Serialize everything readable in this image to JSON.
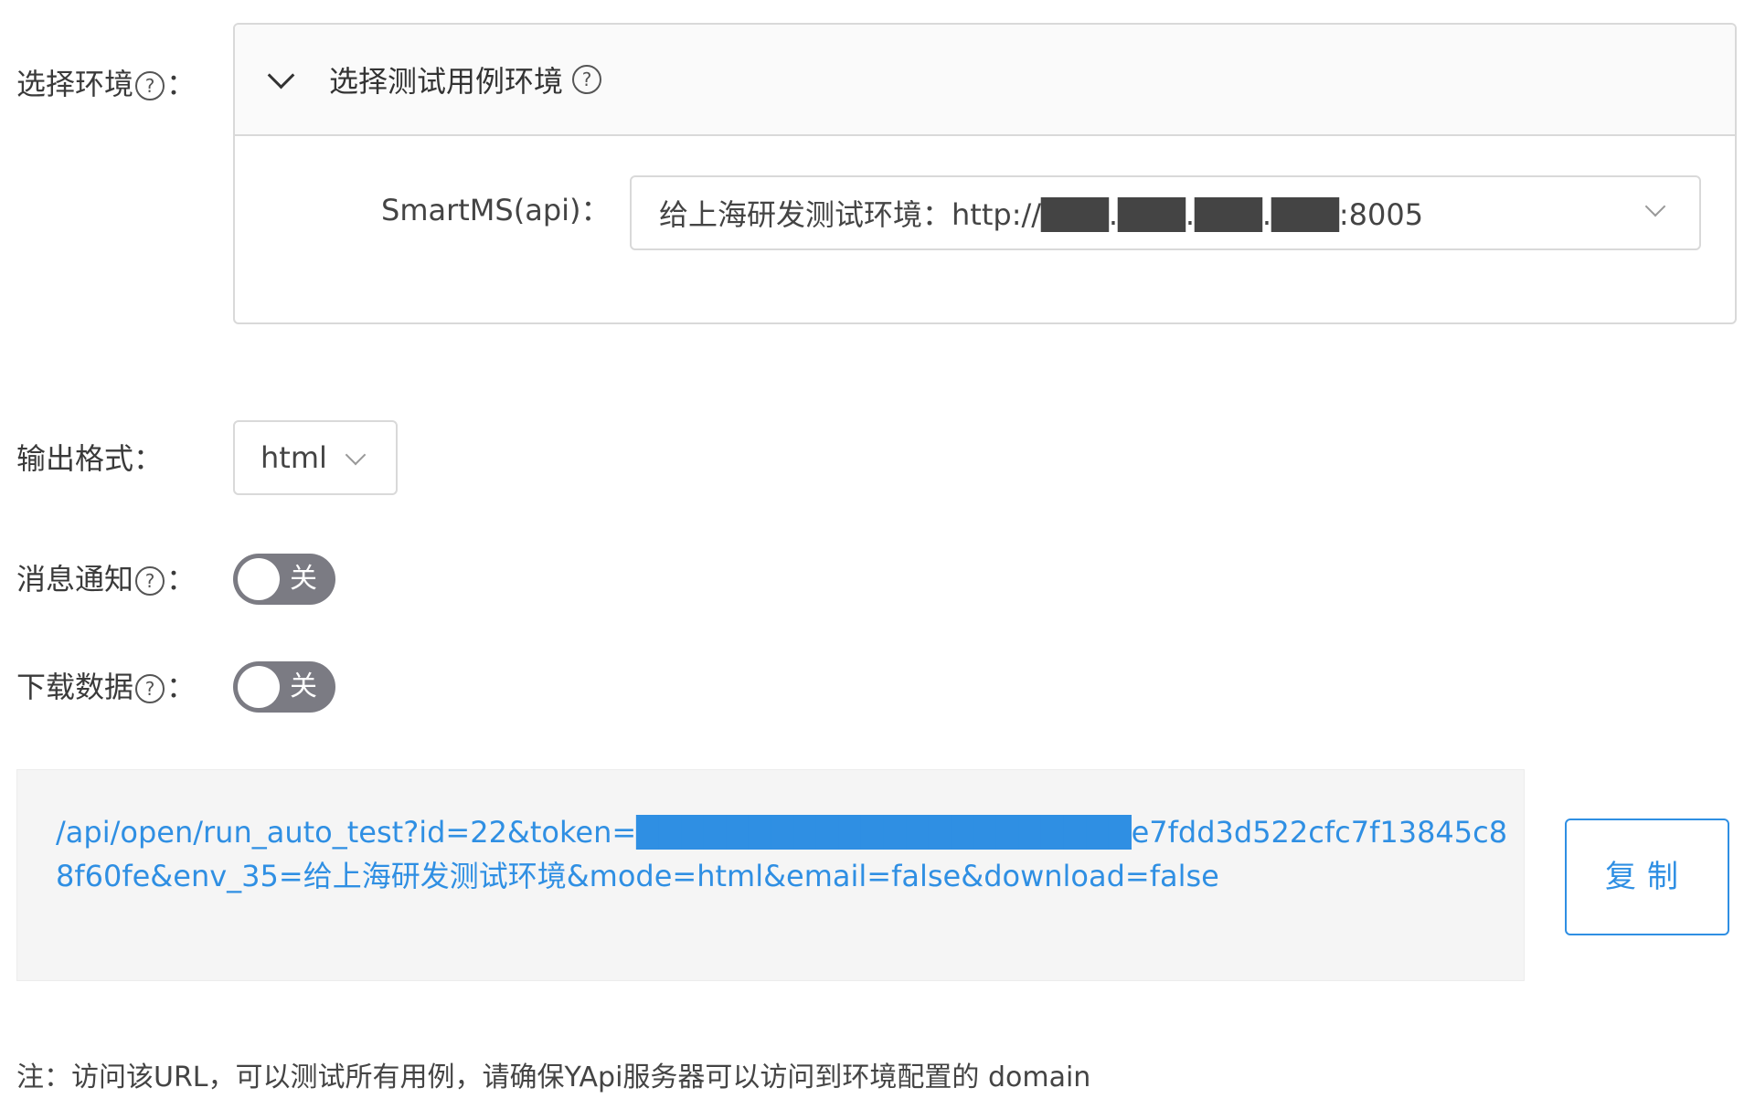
{
  "env_section": {
    "label": "选择环境",
    "label_suffix": "：",
    "help_icon": "?",
    "collapse": {
      "title": "选择测试用例环境",
      "help_icon": "?",
      "project_label": "SmartMS(api)：",
      "selected_env": "给上海研发测试环境：http://███.███.███.███:8005"
    }
  },
  "output_format": {
    "label": "输出格式：",
    "value": "html"
  },
  "message_notify": {
    "label": "消息通知",
    "label_suffix": "：",
    "help_icon": "?",
    "state_text": "关"
  },
  "download_data": {
    "label": "下载数据",
    "label_suffix": "：",
    "help_icon": "?",
    "state_text": "关"
  },
  "url_box": {
    "url": "/api/open/run_auto_test?id=22&token=██████████████████████e7fdd3d522cfc7f13845c88f60fe&env_35=给上海研发测试环境&mode=html&email=false&download=false"
  },
  "copy_button": {
    "label": "复制"
  },
  "note": "注：访问该URL，可以测试所有用例，请确保YApi服务器可以访问到环境配置的 domain",
  "colors": {
    "link": "#2f8fe3",
    "switch_off": "#7b7b83",
    "border": "#d9d9d9"
  }
}
